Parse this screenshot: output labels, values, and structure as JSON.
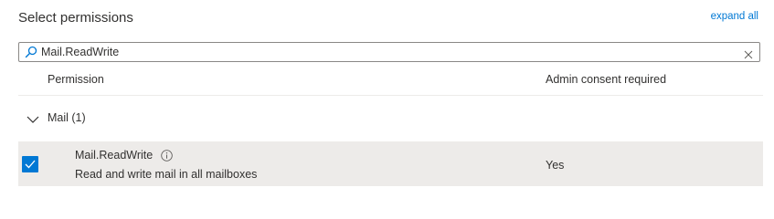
{
  "panel": {
    "title": "Select permissions",
    "expand_all_label": "expand all"
  },
  "search": {
    "value": "Mail.ReadWrite",
    "icon": "search-icon",
    "clear_icon": "close-icon"
  },
  "table": {
    "columns": [
      "Permission",
      "Admin consent required"
    ],
    "groups": [
      {
        "label": "Mail (1)",
        "expanded": true,
        "permissions": [
          {
            "name": "Mail.ReadWrite",
            "description": "Read and write mail in all mailboxes",
            "admin_consent": "Yes",
            "checked": true
          }
        ]
      }
    ]
  },
  "colors": {
    "accent": "#0078d4",
    "selected_row_bg": "#edebe9",
    "text": "#323130"
  }
}
